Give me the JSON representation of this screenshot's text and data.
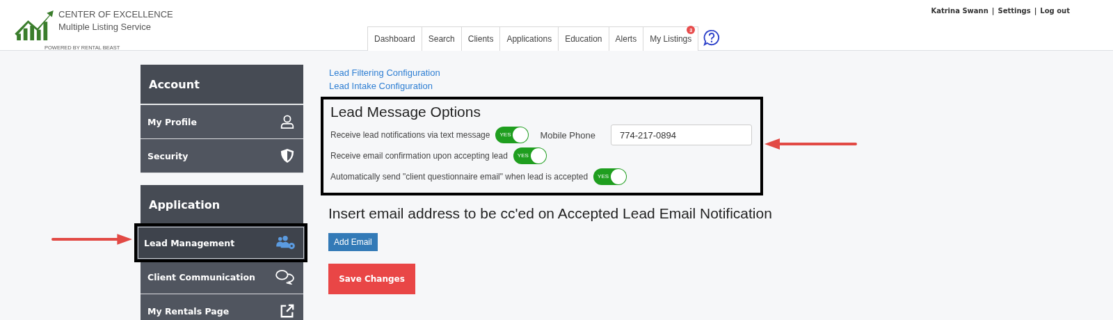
{
  "brand": {
    "title": "CENTER OF  EXCELLENCE",
    "subtitle": "Multiple Listing  Service",
    "powered": "POWERED BY RENTAL BEAST"
  },
  "user_links": [
    "Katrina Swann",
    "Settings",
    "Log out"
  ],
  "separators": [
    "|",
    "|"
  ],
  "nav_tabs": [
    {
      "label": "Dashboard"
    },
    {
      "label": "Search"
    },
    {
      "label": "Clients"
    },
    {
      "label": "Applications"
    },
    {
      "label": "Education"
    },
    {
      "label": "Alerts"
    },
    {
      "label": "My Listings",
      "badge": "3"
    }
  ],
  "sidebar": [
    {
      "title": "Account",
      "items": [
        {
          "label": "My Profile",
          "kind": "user",
          "selected": false,
          "annotated": false
        },
        {
          "label": "Security",
          "kind": "shield",
          "selected": false,
          "annotated": false
        }
      ]
    },
    {
      "title": "Application",
      "items": [
        {
          "label": "Lead Management",
          "kind": "users-gear",
          "selected": true,
          "annotated": true
        },
        {
          "label": "Client Communication",
          "kind": "chat",
          "selected": false,
          "annotated": false
        },
        {
          "label": "My Rentals Page",
          "kind": "external",
          "selected": false,
          "annotated": false
        }
      ]
    }
  ],
  "links": [
    "Lead Filtering Configuration",
    "Lead Intake Configuration"
  ],
  "lead_message_options": {
    "title": "Lead Message Options",
    "annotated": true,
    "options": [
      {
        "label": "Receive lead notifications via text message",
        "on": true,
        "state_label": "YES",
        "field_label": "Mobile Phone",
        "field_value": "774-217-0894"
      },
      {
        "label": "Receive email confirmation upon accepting lead",
        "on": true,
        "state_label": "YES"
      },
      {
        "label": "Automatically send \"client questionnaire email\" when lead is accepted",
        "on": true,
        "state_label": "YES"
      }
    ]
  },
  "cc_heading": "Insert email address to be cc'ed on Accepted Lead Email Notification",
  "add_email_button": "Add Email",
  "save_button": "Save Changes"
}
